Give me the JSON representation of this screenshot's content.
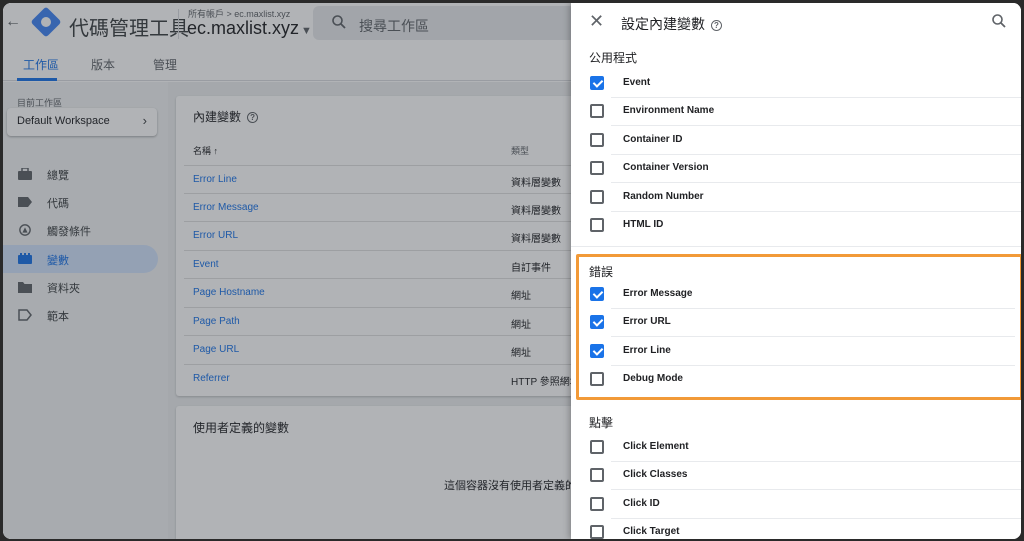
{
  "header": {
    "app_title": "代碼管理工具",
    "account_crumb": "所有帳戶 > ec.maxlist.xyz",
    "container_name": "ec.maxlist.xyz",
    "search_placeholder": "搜尋工作區"
  },
  "tabs": [
    {
      "label": "工作區",
      "active": true
    },
    {
      "label": "版本",
      "active": false
    },
    {
      "label": "管理",
      "active": false
    }
  ],
  "sidebar": {
    "workspace_label": "目前工作區",
    "workspace_name": "Default Workspace",
    "items": [
      {
        "label": "總覽",
        "icon": "briefcase-icon",
        "active": false
      },
      {
        "label": "代碼",
        "icon": "tag-icon",
        "active": false
      },
      {
        "label": "觸發條件",
        "icon": "trigger-icon",
        "active": false
      },
      {
        "label": "變數",
        "icon": "variables-icon",
        "active": true
      },
      {
        "label": "資料夾",
        "icon": "folder-icon",
        "active": false
      },
      {
        "label": "範本",
        "icon": "template-icon",
        "active": false
      }
    ]
  },
  "builtin_card": {
    "title": "內建變數",
    "col_name": "名稱 ↑",
    "col_type": "類型",
    "rows": [
      {
        "name": "Error Line",
        "type": "資料層變數"
      },
      {
        "name": "Error Message",
        "type": "資料層變數"
      },
      {
        "name": "Error URL",
        "type": "資料層變數"
      },
      {
        "name": "Event",
        "type": "自訂事件"
      },
      {
        "name": "Page Hostname",
        "type": "網址"
      },
      {
        "name": "Page Path",
        "type": "網址"
      },
      {
        "name": "Page URL",
        "type": "網址"
      },
      {
        "name": "Referrer",
        "type": "HTTP 參照網址"
      }
    ]
  },
  "user_card": {
    "title": "使用者定義的變數",
    "empty_text": "這個容器沒有使用者定義的"
  },
  "panel": {
    "title": "設定內建變數",
    "sections": [
      {
        "heading": "公用程式",
        "items": [
          {
            "label": "Event",
            "checked": true
          },
          {
            "label": "Environment Name",
            "checked": false
          },
          {
            "label": "Container ID",
            "checked": false
          },
          {
            "label": "Container Version",
            "checked": false
          },
          {
            "label": "Random Number",
            "checked": false
          },
          {
            "label": "HTML ID",
            "checked": false
          }
        ]
      },
      {
        "heading": "錯誤",
        "items": [
          {
            "label": "Error Message",
            "checked": true
          },
          {
            "label": "Error URL",
            "checked": true
          },
          {
            "label": "Error Line",
            "checked": true
          },
          {
            "label": "Debug Mode",
            "checked": false
          }
        ]
      },
      {
        "heading": "點擊",
        "items": [
          {
            "label": "Click Element",
            "checked": false
          },
          {
            "label": "Click Classes",
            "checked": false
          },
          {
            "label": "Click ID",
            "checked": false
          },
          {
            "label": "Click Target",
            "checked": false
          }
        ]
      }
    ]
  },
  "colors": {
    "accent": "#1a73e8",
    "highlight_border": "#f29a38",
    "active_nav_bg": "#d2e3fc"
  }
}
